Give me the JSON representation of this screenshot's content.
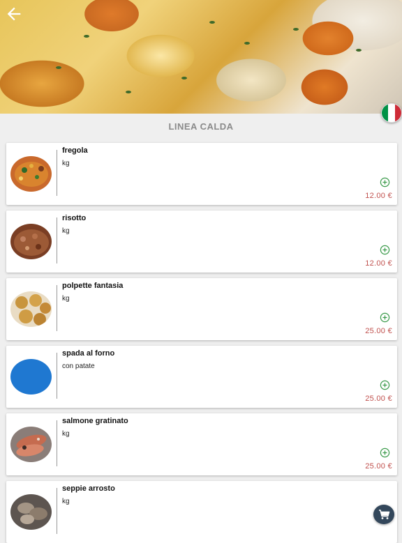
{
  "header": {
    "back_icon": "arrow-left-icon",
    "flag_icon": "italian-flag-icon",
    "flag_colors": [
      "#009246",
      "#ffffff",
      "#ce2b37"
    ]
  },
  "section": {
    "title": "LINEA CALDA"
  },
  "items": [
    {
      "name": "fregola",
      "desc": "kg",
      "price": "12.00 €",
      "photo": "fregola-dish"
    },
    {
      "name": "risotto",
      "desc": "kg",
      "price": "12.00 €",
      "photo": "risotto-dish"
    },
    {
      "name": "polpette fantasia",
      "desc": "kg",
      "price": "25.00 €",
      "photo": "meatballs-dish"
    },
    {
      "name": "spada al forno",
      "desc": "con patate",
      "price": "25.00 €",
      "photo": "placeholder-blue-circle"
    },
    {
      "name": "salmone gratinato",
      "desc": "kg",
      "price": "25.00 €",
      "photo": "salmon-dish"
    },
    {
      "name": "seppie arrosto",
      "desc": "kg",
      "price": "",
      "photo": "cuttlefish-dish"
    }
  ],
  "colors": {
    "price": "#c0504d",
    "add_icon": "#3a9a4a",
    "cart_button": "#33475b",
    "placeholder": "#1f78d1"
  },
  "cart": {
    "icon": "shopping-cart-icon"
  }
}
